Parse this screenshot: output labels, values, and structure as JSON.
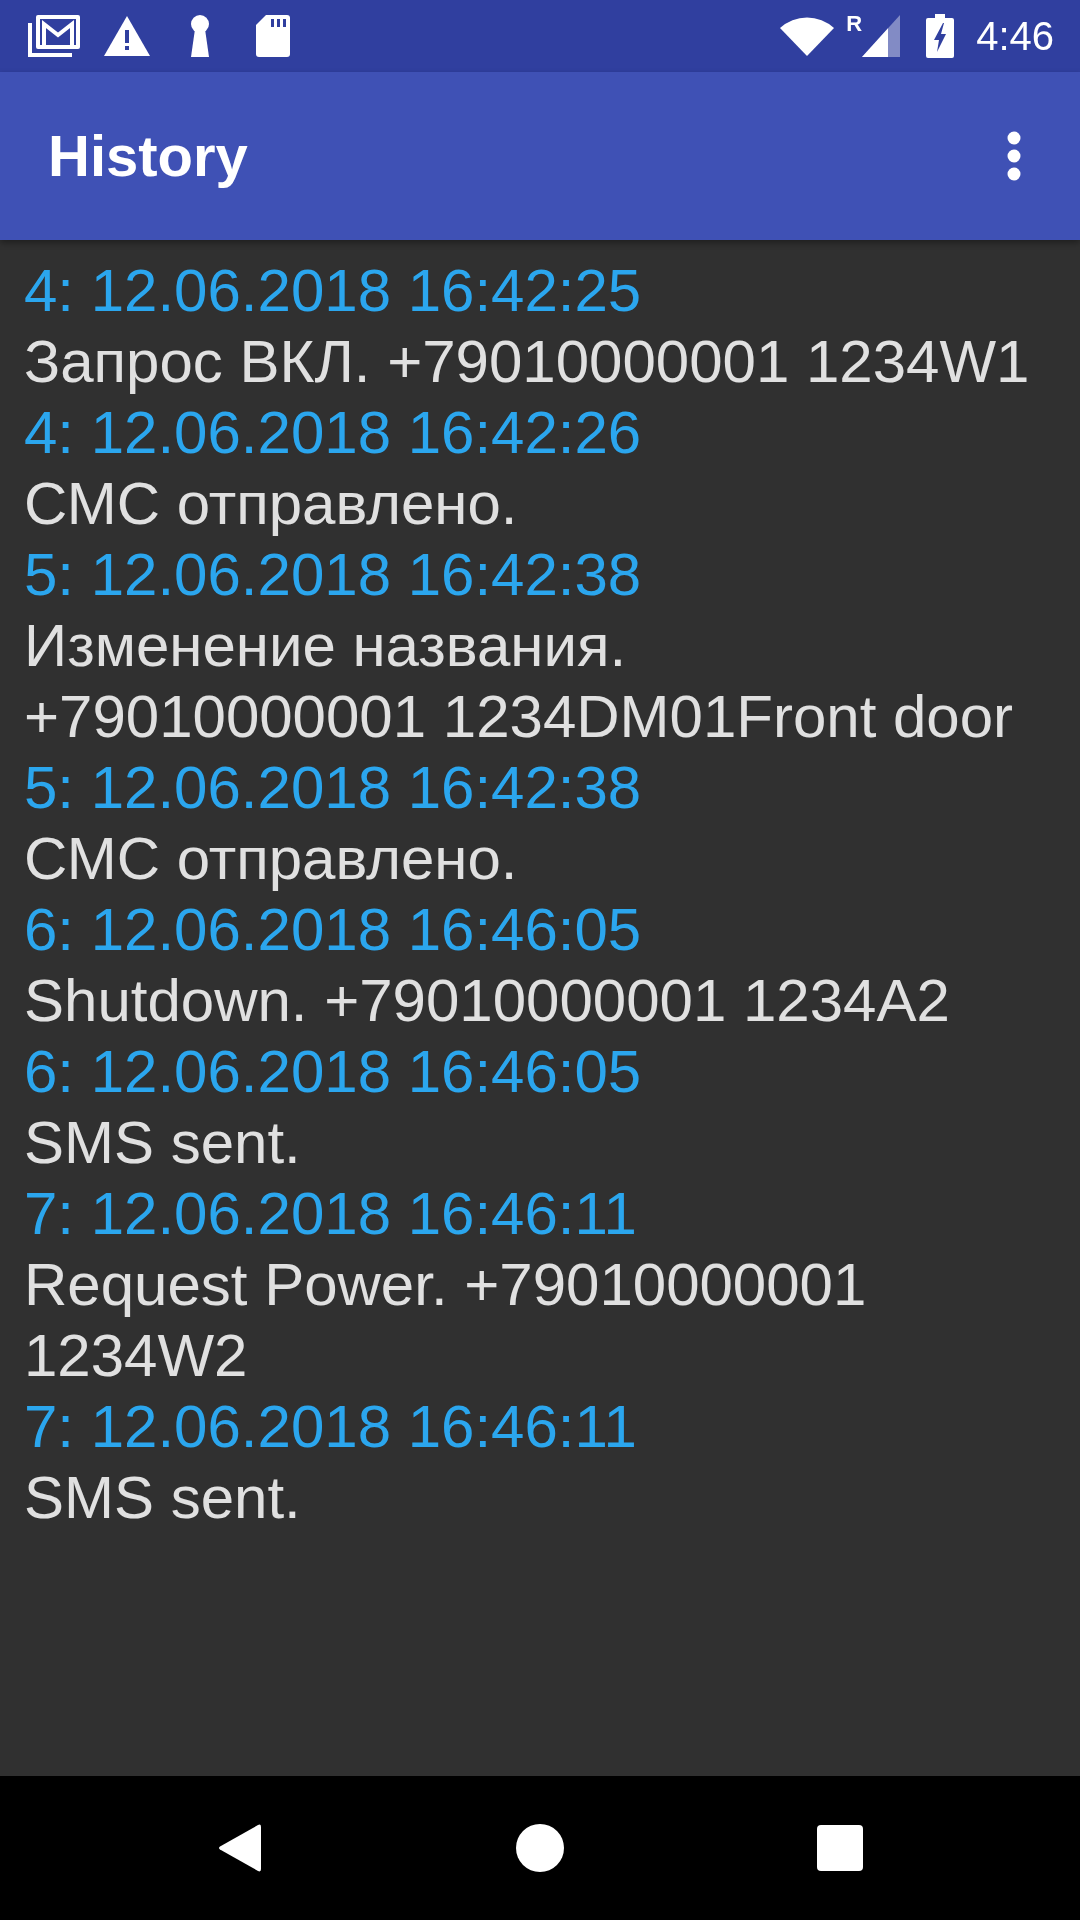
{
  "status_bar": {
    "roaming_indicator": "R",
    "time": "4:46"
  },
  "app_bar": {
    "title": "History"
  },
  "entries": [
    {
      "time": "4: 12.06.2018 16:42:25",
      "message": "Запрос ВКЛ. +79010000001 1234W1"
    },
    {
      "time": "4: 12.06.2018 16:42:26",
      "message": "СМС отправлено."
    },
    {
      "time": "5: 12.06.2018 16:42:38",
      "message": "Изменение названия.\n+79010000001 1234DM01Front door"
    },
    {
      "time": "5: 12.06.2018 16:42:38",
      "message": "СМС отправлено."
    },
    {
      "time": "6: 12.06.2018 16:46:05",
      "message": "Shutdown. +79010000001 1234A2"
    },
    {
      "time": "6: 12.06.2018 16:46:05",
      "message": "SMS sent."
    },
    {
      "time": "7: 12.06.2018 16:46:11",
      "message": "Request Power. +79010000001\n1234W2"
    },
    {
      "time": "7: 12.06.2018 16:46:11",
      "message": "SMS sent."
    }
  ]
}
